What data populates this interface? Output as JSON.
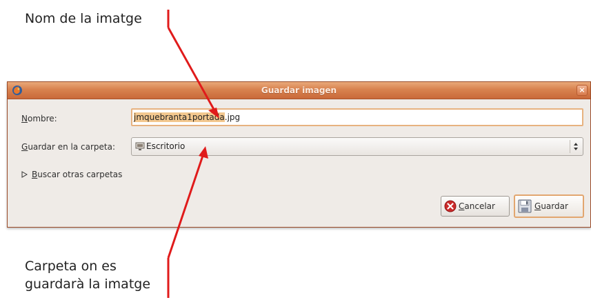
{
  "annotations": {
    "top": "Nom de la imatge",
    "bottom": "Carpeta on es\nguardarà la imatge"
  },
  "dialog": {
    "title": "Guardar imagen",
    "name_label_key": "N",
    "name_label_rest": "ombre:",
    "name_value_selected": "jmquebranta1portada",
    "name_value_ext": ".jpg",
    "folder_label_key": "G",
    "folder_label_rest": "uardar en la carpeta:",
    "folder_value": "Escritorio",
    "expander_key": "B",
    "expander_rest": "uscar otras carpetas",
    "cancel_key": "C",
    "cancel_rest": "ancelar",
    "save_key": "G",
    "save_rest": "uardar"
  },
  "colors": {
    "arrow": "#e01b1b",
    "titlebar": "#d8824f",
    "selection": "#f3c88f",
    "focus_border": "#e2a66f"
  },
  "icons": {
    "window": "firefox-icon",
    "close": "close-icon",
    "folder": "desktop-folder-icon",
    "combo": "combo-arrows-icon",
    "expander": "expander-triangle-icon",
    "cancel": "cancel-icon",
    "save": "save-icon"
  }
}
